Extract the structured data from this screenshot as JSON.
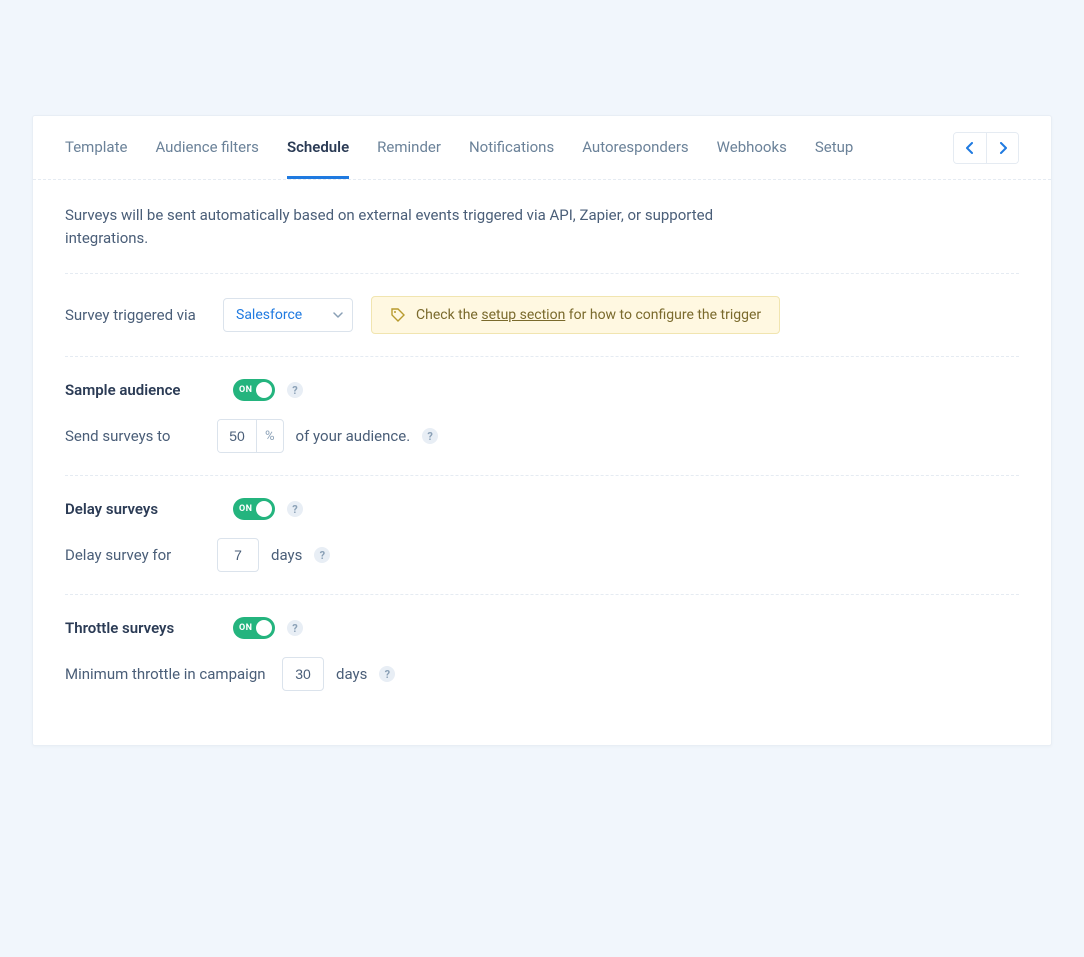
{
  "tabs": [
    {
      "label": "Template"
    },
    {
      "label": "Audience filters"
    },
    {
      "label": "Schedule",
      "active": true
    },
    {
      "label": "Reminder"
    },
    {
      "label": "Notifications"
    },
    {
      "label": "Autoresponders"
    },
    {
      "label": "Webhooks"
    },
    {
      "label": "Setup"
    }
  ],
  "intro": "Surveys will be sent automatically based on external events triggered via API, Zapier, or supported integrations.",
  "trigger": {
    "label": "Survey triggered via",
    "value": "Salesforce",
    "banner_pre": "Check the ",
    "banner_link": "setup section",
    "banner_post": " for how to configure the trigger"
  },
  "sample": {
    "title": "Sample audience",
    "toggle": "ON",
    "send_prefix": "Send surveys to",
    "percent_value": "50",
    "percent_unit": "%",
    "send_suffix": "of your audience."
  },
  "delay": {
    "title": "Delay surveys",
    "toggle": "ON",
    "prefix": "Delay survey for",
    "value": "7",
    "unit": "days"
  },
  "throttle": {
    "title": "Throttle surveys",
    "toggle": "ON",
    "prefix": "Minimum throttle in campaign",
    "value": "30",
    "unit": "days"
  }
}
